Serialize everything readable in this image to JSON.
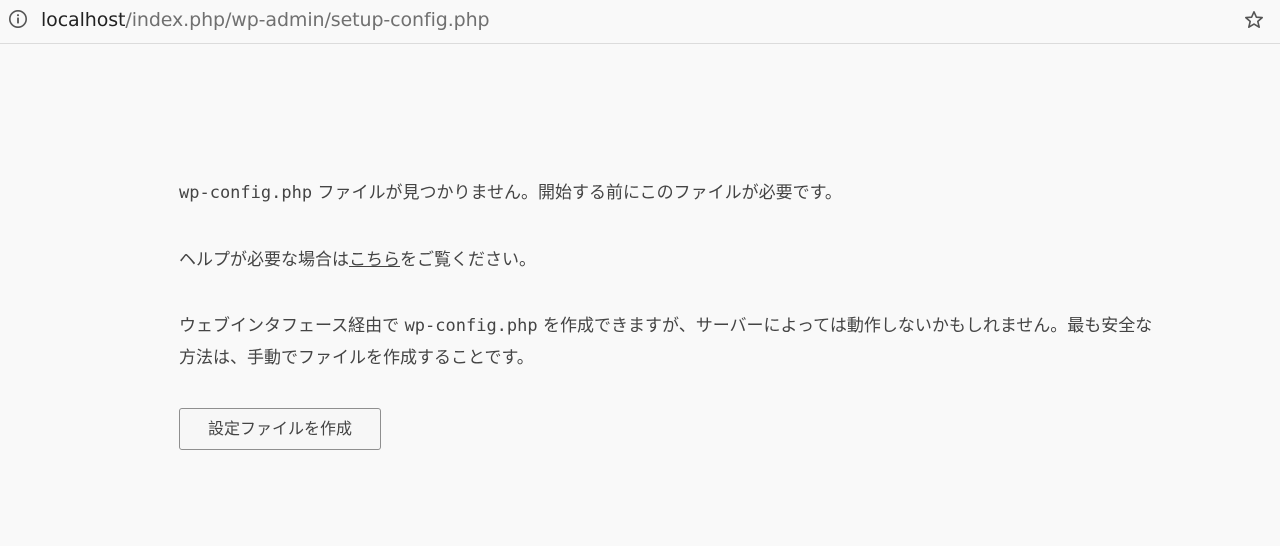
{
  "addressbar": {
    "url_host": "localhost",
    "url_path": "/index.php/wp-admin/setup-config.php",
    "info_icon": "info-circle-icon",
    "star_icon": "bookmark-star-icon"
  },
  "message": {
    "p1_code": "wp-config.php",
    "p1_text": " ファイルが見つかりません。開始する前にこのファイルが必要です。",
    "p2_before": "ヘルプが必要な場合は",
    "p2_link": "こちら",
    "p2_after": "をご覧ください。",
    "p3_before": "ウェブインタフェース経由で ",
    "p3_code": "wp-config.php",
    "p3_after": " を作成できますが、サーバーによっては動作しないかもしれません。最も安全な方法は、手動でファイルを作成することです。"
  },
  "button": {
    "label": "設定ファイルを作成"
  }
}
